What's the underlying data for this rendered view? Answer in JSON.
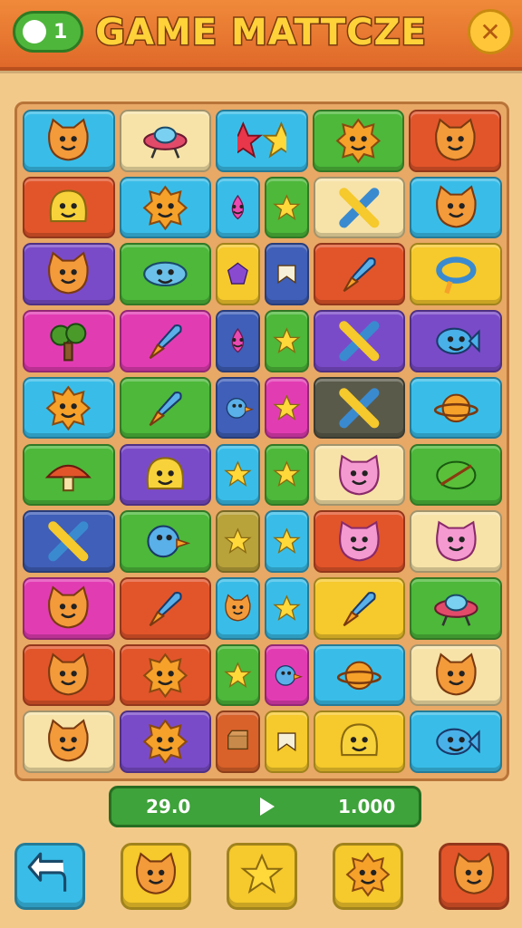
{
  "header": {
    "title": "GAME MATTCZE",
    "coins": "1",
    "close_glyph": "✕"
  },
  "score": {
    "left": "29.0",
    "right": "1.000"
  },
  "colors": {
    "blue": "#39bde8",
    "cream": "#f7e3a8",
    "green": "#4db83a",
    "red": "#e2552a",
    "purple": "#7a4bc8",
    "magenta": "#e23cb3",
    "yellow": "#f6c92c",
    "navy": "#3f5fb8",
    "dark": "#5a5a4a",
    "olive": "#b8a23a",
    "brick": "#d9622a"
  },
  "board": {
    "rows": [
      [
        {
          "c": "blue",
          "icon": "cat"
        },
        {
          "c": "cream",
          "icon": "ufo"
        },
        {
          "c": "blue",
          "icon": "stars-pair"
        },
        {
          "c": "green",
          "icon": "sun"
        },
        {
          "c": "red",
          "icon": "cat"
        }
      ],
      [
        {
          "c": "red",
          "icon": "blob"
        },
        {
          "c": "blue",
          "icon": "sun"
        },
        {
          "c": "blue",
          "icon": "drop",
          "half": true
        },
        {
          "c": "green",
          "icon": "star",
          "half": true
        },
        {
          "c": "cream",
          "icon": "cross"
        },
        {
          "c": "blue",
          "icon": "cat"
        }
      ],
      [
        {
          "c": "purple",
          "icon": "cat"
        },
        {
          "c": "green",
          "icon": "saucer"
        },
        {
          "c": "yellow",
          "icon": "gem",
          "half": true
        },
        {
          "c": "navy",
          "icon": "flag",
          "half": true
        },
        {
          "c": "red",
          "icon": "rocket"
        },
        {
          "c": "yellow",
          "icon": "ring"
        }
      ],
      [
        {
          "c": "magenta",
          "icon": "tree"
        },
        {
          "c": "magenta",
          "icon": "rocket"
        },
        {
          "c": "navy",
          "icon": "drop",
          "half": true
        },
        {
          "c": "green",
          "icon": "star",
          "half": true
        },
        {
          "c": "purple",
          "icon": "cross"
        },
        {
          "c": "purple",
          "icon": "fish"
        }
      ],
      [
        {
          "c": "blue",
          "icon": "sun"
        },
        {
          "c": "green",
          "icon": "rocket"
        },
        {
          "c": "navy",
          "icon": "bird",
          "half": true
        },
        {
          "c": "magenta",
          "icon": "star",
          "half": true
        },
        {
          "c": "dark",
          "icon": "cross"
        },
        {
          "c": "blue",
          "icon": "planet"
        }
      ],
      [
        {
          "c": "green",
          "icon": "mushroom"
        },
        {
          "c": "purple",
          "icon": "blob"
        },
        {
          "c": "blue",
          "icon": "star",
          "half": true
        },
        {
          "c": "green",
          "icon": "star",
          "half": true
        },
        {
          "c": "cream",
          "icon": "pig"
        },
        {
          "c": "green",
          "icon": "leaf"
        }
      ],
      [
        {
          "c": "navy",
          "icon": "cross"
        },
        {
          "c": "green",
          "icon": "bird"
        },
        {
          "c": "olive",
          "icon": "star",
          "half": true
        },
        {
          "c": "blue",
          "icon": "star",
          "half": true
        },
        {
          "c": "red",
          "icon": "pig"
        },
        {
          "c": "cream",
          "icon": "pig"
        }
      ],
      [
        {
          "c": "magenta",
          "icon": "cat"
        },
        {
          "c": "red",
          "icon": "rocket"
        },
        {
          "c": "blue",
          "icon": "cat",
          "half": true
        },
        {
          "c": "blue",
          "icon": "star",
          "half": true
        },
        {
          "c": "yellow",
          "icon": "rocket"
        },
        {
          "c": "green",
          "icon": "ufo"
        }
      ],
      [
        {
          "c": "red",
          "icon": "cat"
        },
        {
          "c": "red",
          "icon": "sun"
        },
        {
          "c": "green",
          "icon": "star",
          "half": true
        },
        {
          "c": "magenta",
          "icon": "bird",
          "half": true
        },
        {
          "c": "blue",
          "icon": "planet"
        },
        {
          "c": "cream",
          "icon": "cat"
        }
      ],
      [
        {
          "c": "cream",
          "icon": "cat"
        },
        {
          "c": "purple",
          "icon": "sun"
        },
        {
          "c": "brick",
          "icon": "box",
          "half": true
        },
        {
          "c": "yellow",
          "icon": "flag",
          "half": true
        },
        {
          "c": "yellow",
          "icon": "blob"
        },
        {
          "c": "blue",
          "icon": "fish"
        }
      ]
    ]
  },
  "toolbar": [
    {
      "name": "undo-button",
      "icon": "undo",
      "c": "#39bde8"
    },
    {
      "name": "booster-cat-button",
      "icon": "cat",
      "c": "#f6c92c"
    },
    {
      "name": "booster-star-button",
      "icon": "star",
      "c": "#f6c92c"
    },
    {
      "name": "booster-sun-button",
      "icon": "sun",
      "c": "#f6c92c"
    },
    {
      "name": "booster-frog-button",
      "icon": "cat",
      "c": "#e2552a"
    }
  ]
}
